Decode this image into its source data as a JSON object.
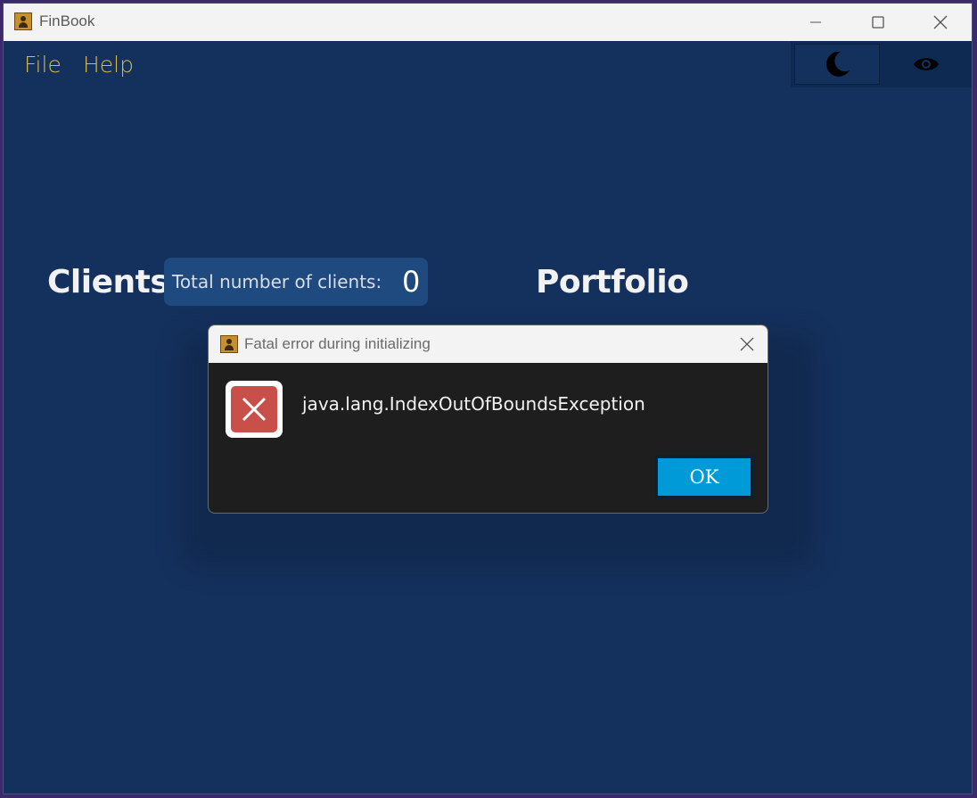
{
  "window": {
    "title": "FinBook",
    "minimize_label": "Minimize",
    "maximize_label": "Maximize",
    "close_label": "Close",
    "icon": "address-book-icon"
  },
  "menubar": {
    "items": [
      {
        "label": "File"
      },
      {
        "label": "Help"
      }
    ]
  },
  "toolbar": {
    "theme_icon": "moon-icon",
    "view_icon": "eye-icon"
  },
  "main": {
    "clients_title": "Clients",
    "count_label": "Total number of clients:",
    "count_value": "0",
    "portfolio_title": "Portfolio"
  },
  "dialog": {
    "title": "Fatal error during initializing",
    "message": "java.lang.IndexOutOfBoundsException",
    "ok_label": "OK",
    "icon": "error-icon"
  },
  "colors": {
    "background": "#14305c",
    "menu_text": "#d8b84a",
    "count_badge": "#1e4a80",
    "dialog_body": "#1e1e1e",
    "ok_button": "#009ad8",
    "error_icon": "#c9504a"
  }
}
